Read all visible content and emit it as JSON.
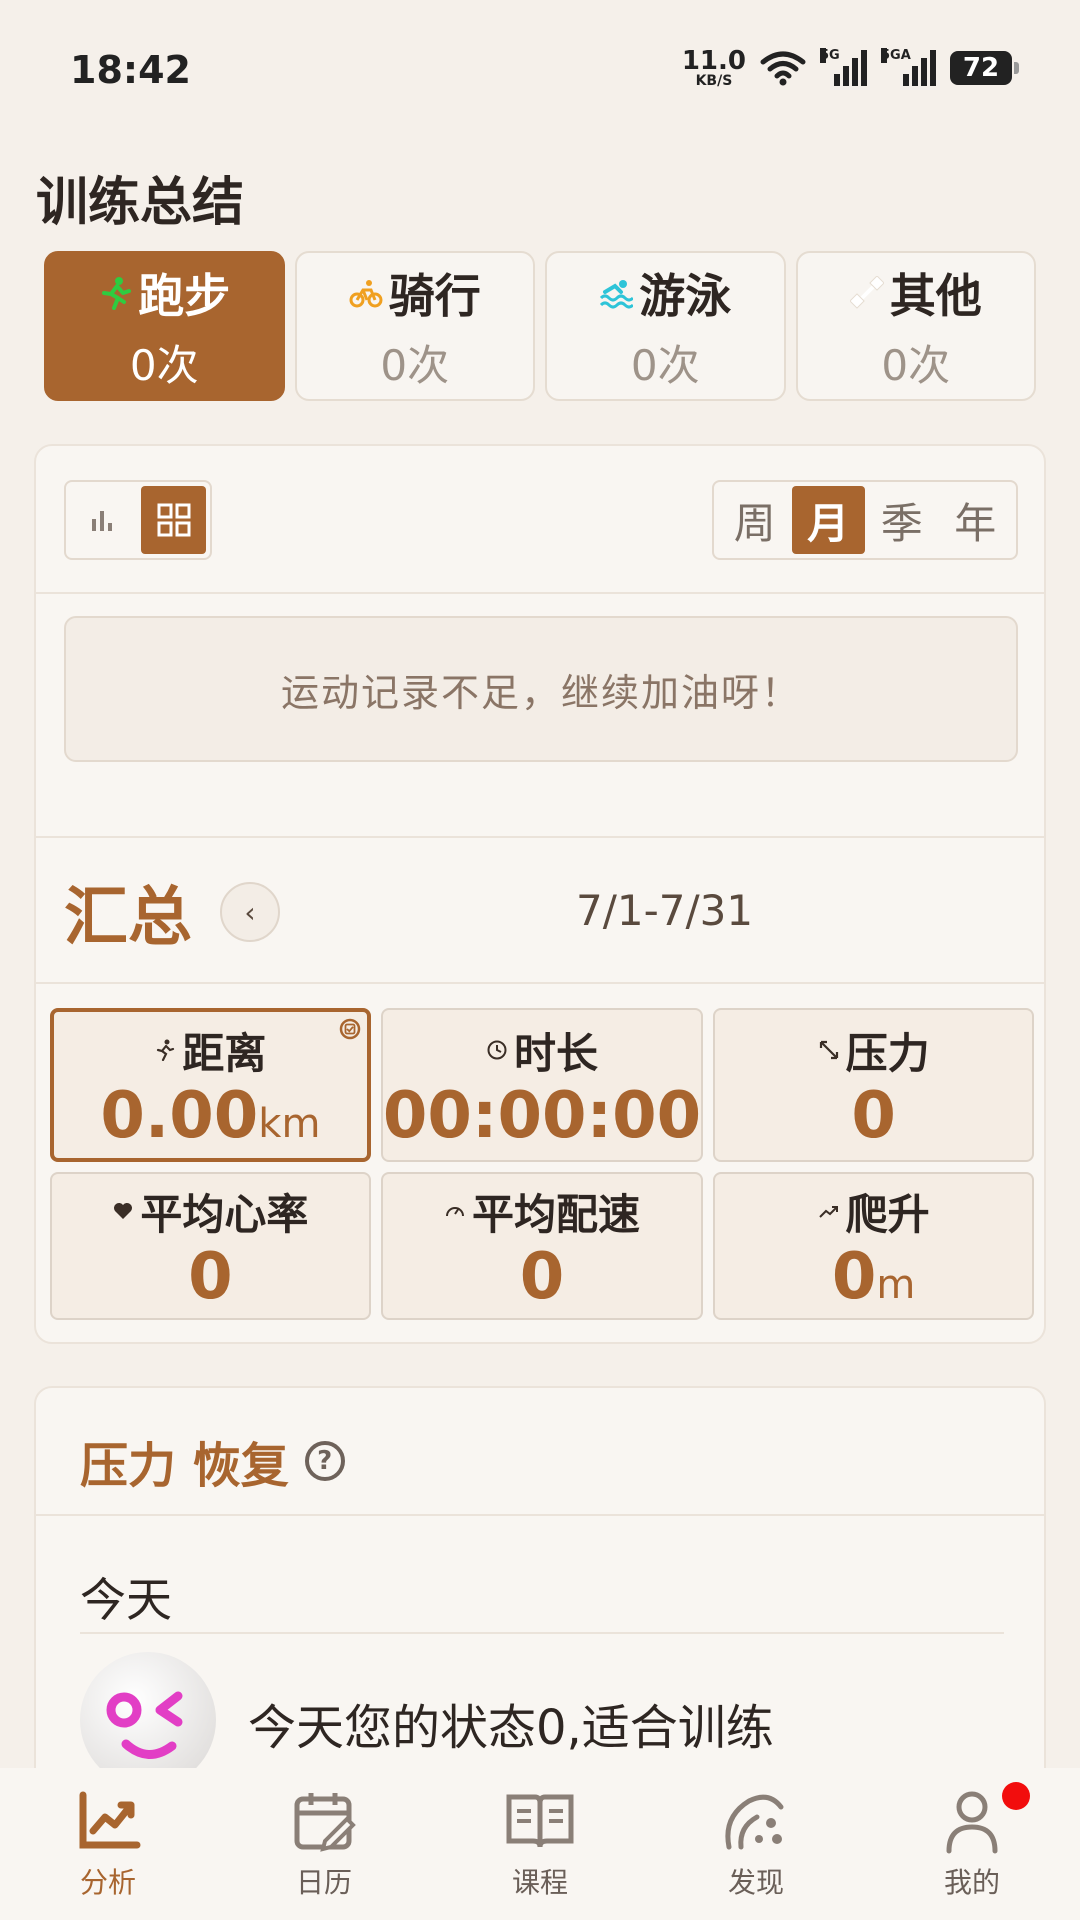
{
  "status_bar": {
    "time": "18:42",
    "net_speed": "11.0",
    "net_unit": "KB/S",
    "signal1_tag": "5G",
    "signal2_tag": "5GA",
    "battery": "72"
  },
  "page_title": "训练总结",
  "sport_tabs": [
    {
      "name": "跑步",
      "count": "0次",
      "icon": "running-icon",
      "active": true
    },
    {
      "name": "骑行",
      "count": "0次",
      "icon": "cycling-icon",
      "active": false
    },
    {
      "name": "游泳",
      "count": "0次",
      "icon": "swimming-icon",
      "active": false
    },
    {
      "name": "其他",
      "count": "0次",
      "icon": "dumbbell-icon",
      "active": false
    }
  ],
  "view_toggle": {
    "chart_icon": "bar-chart-icon",
    "grid_icon": "grid-icon",
    "active": "grid"
  },
  "period_toggle": {
    "options": [
      "周",
      "月",
      "季",
      "年"
    ],
    "active": "月"
  },
  "empty_message": "运动记录不足，继续加油呀！",
  "summary": {
    "title": "汇总",
    "date_range": "7/1-7/31",
    "stats": [
      {
        "label": "距离",
        "value": "0.00",
        "unit": "km",
        "icon": "runner-icon",
        "selected": true
      },
      {
        "label": "时长",
        "value": "00:00:00",
        "unit": "",
        "icon": "clock-icon"
      },
      {
        "label": "压力",
        "value": "0",
        "unit": "",
        "icon": "arrows-icon"
      },
      {
        "label": "平均心率",
        "value": "0",
        "unit": "",
        "icon": "heart-icon"
      },
      {
        "label": "平均配速",
        "value": "0",
        "unit": "",
        "icon": "speedometer-icon"
      },
      {
        "label": "爬升",
        "value": "0",
        "unit": "m",
        "icon": "trend-up-icon"
      }
    ]
  },
  "stress_recovery": {
    "title": "压力 恢复",
    "today_label": "今天",
    "status_message": "今天您的状态0,适合训练"
  },
  "bottom_nav": [
    {
      "label": "分析",
      "icon": "analytics-icon",
      "active": true
    },
    {
      "label": "日历",
      "icon": "calendar-icon",
      "active": false
    },
    {
      "label": "课程",
      "icon": "book-icon",
      "active": false
    },
    {
      "label": "发现",
      "icon": "discover-icon",
      "active": false
    },
    {
      "label": "我的",
      "icon": "profile-icon",
      "active": false,
      "badge": true
    }
  ],
  "colors": {
    "accent": "#a8652f",
    "background": "#f5f0ea",
    "card": "#f9f6f2",
    "notification": "#f20d0d"
  }
}
